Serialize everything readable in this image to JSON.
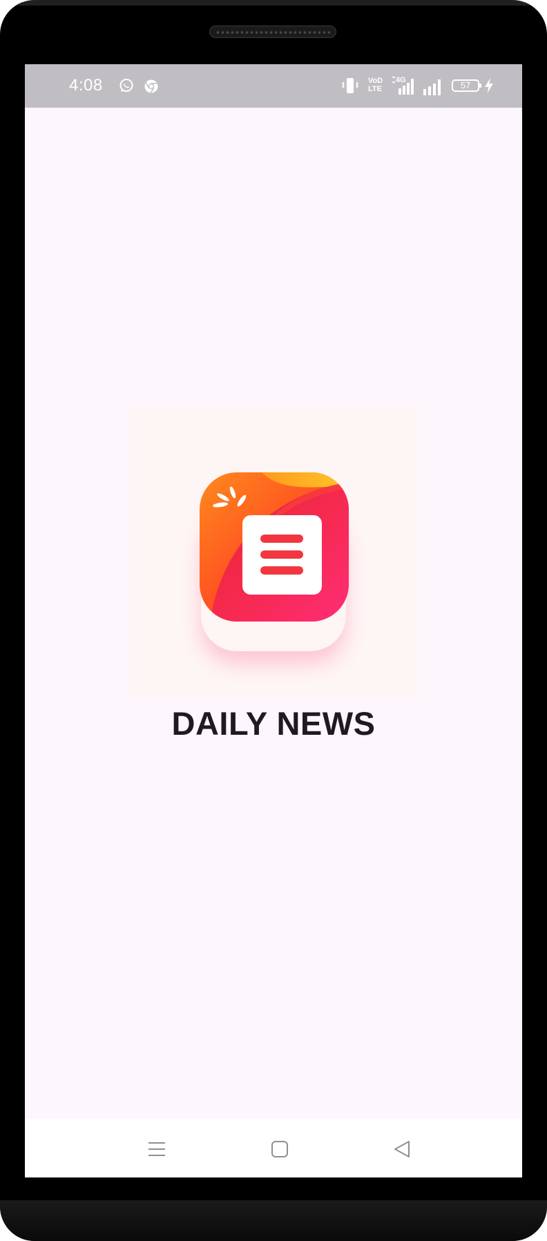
{
  "status_bar": {
    "time": "4:08",
    "notification_icons": [
      "whatsapp-icon",
      "chrome-icon"
    ],
    "system_icons": [
      "vibrate-icon",
      "volte-icon",
      "4g-signal-icon",
      "signal-icon",
      "battery-icon",
      "charging-icon"
    ],
    "volte_line1": "VoD",
    "volte_line2": "LTE",
    "network_label": "4G",
    "battery_level": "57"
  },
  "splash": {
    "app_name": "DAILY NEWS",
    "logo_icon": "news-app-logo-icon"
  },
  "nav_bar": {
    "buttons": [
      "recents-menu-icon",
      "home-square-icon",
      "back-triangle-icon"
    ]
  },
  "colors": {
    "status_bar_bg": "#c1bec3",
    "screen_bg": "#fdf6fc",
    "logo_orange": "#ff6a1a",
    "logo_pink": "#ff2a6e",
    "logo_red": "#e0242e",
    "logo_yellow": "#ffbf2a",
    "title_text": "#1f1a22"
  }
}
